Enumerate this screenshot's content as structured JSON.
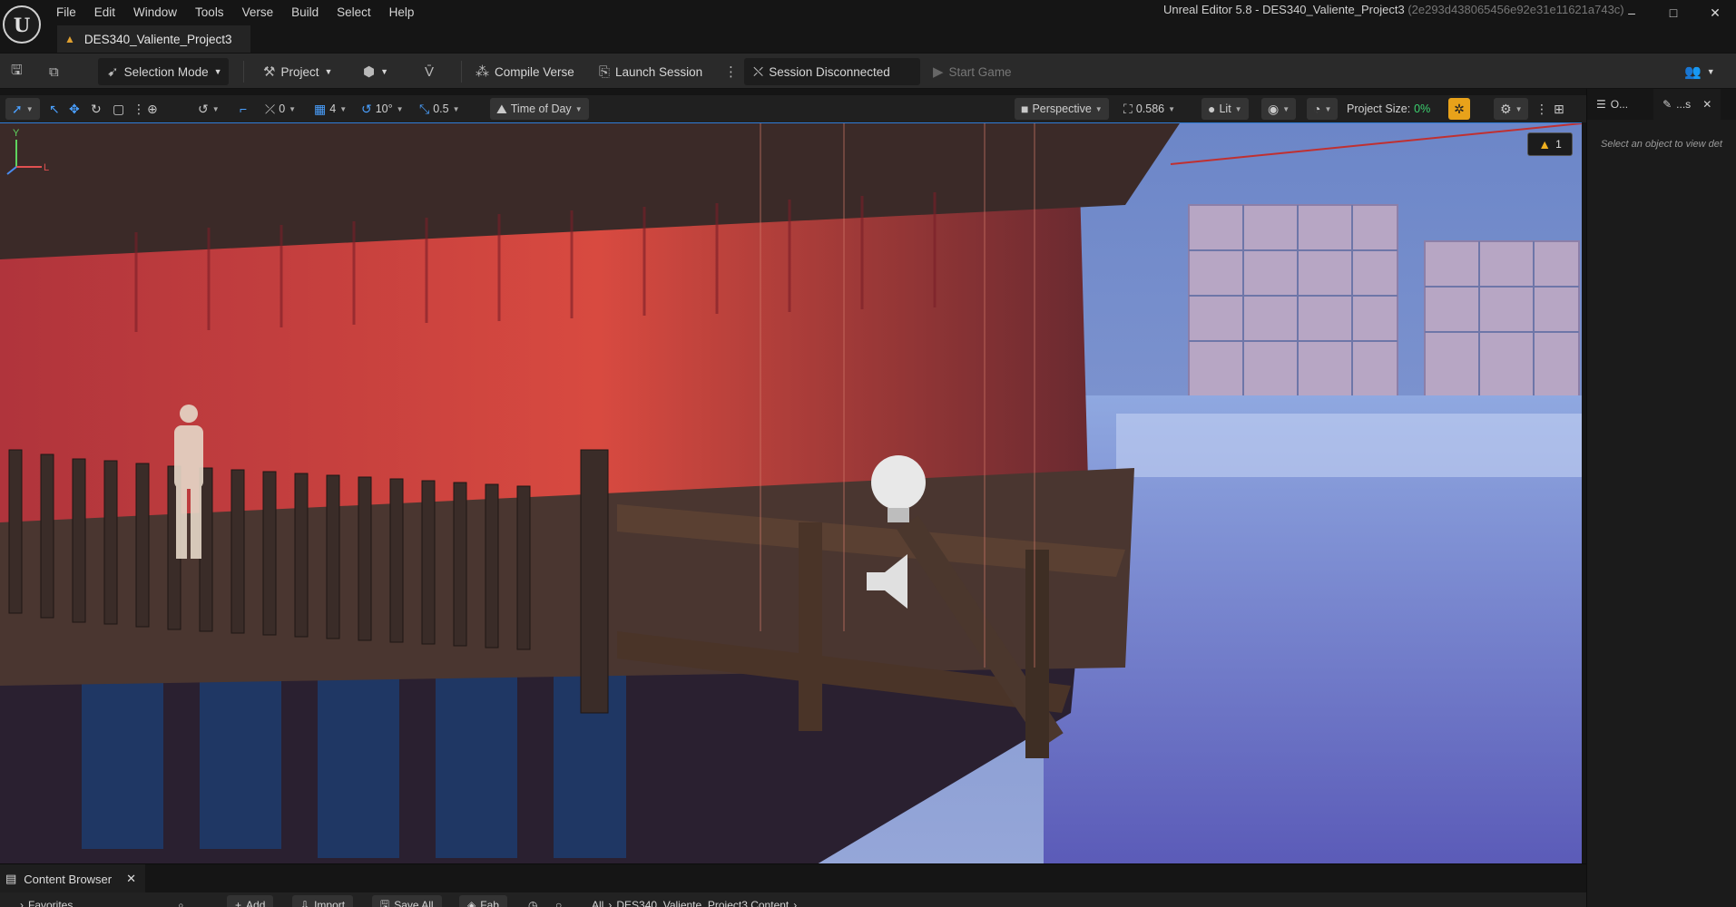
{
  "app": {
    "window_title": "Unreal Editor 5.8 - DES340_Valiente_Project3",
    "window_hash": "(2e293d438065456e92e31e11621a743c)",
    "logo_text": "U"
  },
  "menu": [
    "File",
    "Edit",
    "Window",
    "Tools",
    "Verse",
    "Build",
    "Select",
    "Help"
  ],
  "window_controls": {
    "minimize": "–",
    "maximize": "□",
    "close": "✕"
  },
  "document_tab": {
    "label": "DES340_Valiente_Project3"
  },
  "toolbar": {
    "selection_mode": "Selection Mode",
    "project": "Project",
    "compile_verse": "Compile Verse",
    "launch_session": "Launch Session",
    "session_status": "Session Disconnected",
    "start_game": "Start Game"
  },
  "viewport_toolbar": {
    "rotation_snap": "0",
    "grid_snap": "4",
    "angle_snap": "10°",
    "scale_snap": "0.5",
    "time_of_day": "Time of Day",
    "perspective": "Perspective",
    "camera_speed": "0.586",
    "lit": "Lit",
    "project_size_label": "Project Size:",
    "project_size_value": "0%"
  },
  "viewport": {
    "warning_count": "1",
    "axis_z": "Y",
    "axis_x": "L"
  },
  "details_panel": {
    "tab_outliner": "O...",
    "tab_details": "...s",
    "hint": "Select an object to view det"
  },
  "content_browser": {
    "tab_label": "Content Browser",
    "favorites": "Favorites",
    "add": "Add",
    "import": "Import",
    "save_all": "Save All",
    "fab": "Fab",
    "path_all": "All",
    "path_content": "DES340_Valiente_Project3 Content"
  },
  "colors": {
    "accent_blue": "#2f7dd8",
    "project_size_green": "#3bd16f",
    "warning_yellow": "#e8a21a"
  }
}
